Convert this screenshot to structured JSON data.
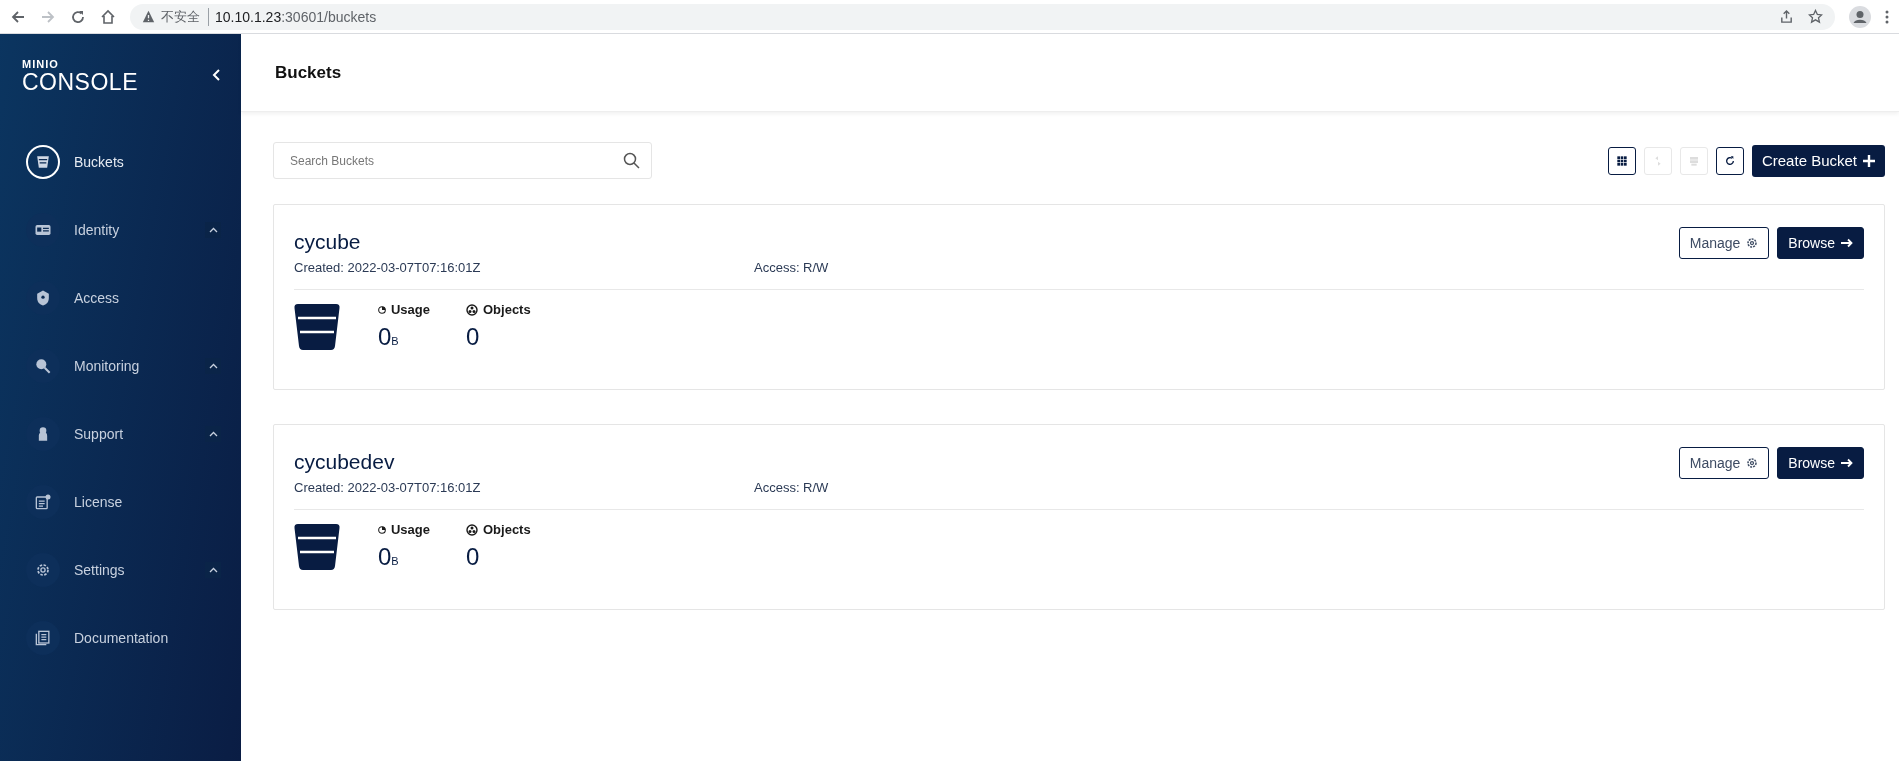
{
  "browser": {
    "security_label": "不安全",
    "url_host": "10.10.1.23",
    "url_path": ":30601/buckets"
  },
  "sidebar": {
    "logo_top": "MINIO",
    "logo_bottom": "CONSOLE",
    "items": [
      {
        "label": "Buckets",
        "selected": true,
        "submenu": false
      },
      {
        "label": "Identity",
        "selected": false,
        "submenu": true
      },
      {
        "label": "Access",
        "selected": false,
        "submenu": false
      },
      {
        "label": "Monitoring",
        "selected": false,
        "submenu": true
      },
      {
        "label": "Support",
        "selected": false,
        "submenu": true
      },
      {
        "label": "License",
        "selected": false,
        "submenu": false
      },
      {
        "label": "Settings",
        "selected": false,
        "submenu": true
      },
      {
        "label": "Documentation",
        "selected": false,
        "submenu": false
      }
    ]
  },
  "page_title": "Buckets",
  "search": {
    "placeholder": "Search Buckets"
  },
  "toolbar": {
    "tools": [
      {
        "disabled": false
      },
      {
        "disabled": true
      },
      {
        "disabled": true
      },
      {
        "disabled": false
      }
    ],
    "create_button": "Create Bucket"
  },
  "buckets": [
    {
      "name": "cycube",
      "created": "Created: 2022-03-07T07:16:01Z",
      "access": "Access: R/W",
      "manage": "Manage",
      "browse": "Browse",
      "usage_label": "Usage",
      "usage": "0$_{B}$",
      "objects_label": "Objects",
      "objects": "0"
    },
    {
      "name": "cycubedev",
      "created": "Created: 2022-03-07T07:16:01Z",
      "access": "Access: R/W",
      "manage": "Manage",
      "browse": "Browse",
      "usage_label": "Usage",
      "usage": "0$_{B}$",
      "objects_label": "Objects",
      "objects": "0"
    }
  ]
}
